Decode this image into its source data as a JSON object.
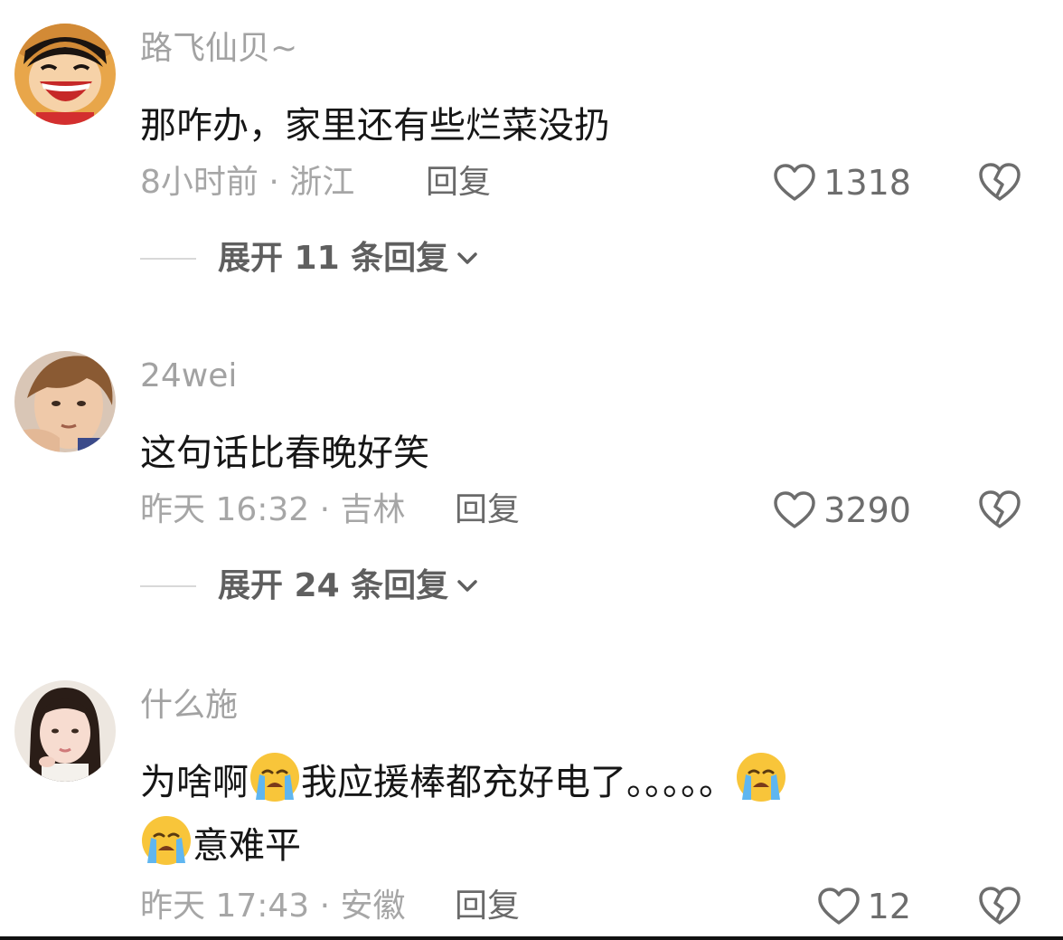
{
  "comments": [
    {
      "username": "路飞仙贝~",
      "text": "那咋办，家里还有些烂菜没扔",
      "time_location": "8小时前 · 浙江",
      "reply_label": "回复",
      "likes": "1318",
      "expand_label": "展开 11 条回复",
      "avatar": "avatar-cartoon-boy-icon"
    },
    {
      "username": "24wei",
      "text": "这句话比春晚好笑",
      "time_location": "昨天 16:32 · 吉林",
      "reply_label": "回复",
      "likes": "3290",
      "expand_label": "展开 24 条回复",
      "avatar": "avatar-young-man-icon"
    },
    {
      "username": "什么施",
      "text_part1": "为啥啊",
      "text_part2": "我应援棒都充好电了。。。。。",
      "text_part3": "意难平",
      "time_location": "昨天 17:43 · 安徽",
      "reply_label": "回复",
      "likes": "12",
      "avatar": "avatar-young-woman-icon"
    }
  ],
  "icons": {
    "like": "heart-icon",
    "dislike": "broken-heart-icon",
    "expand": "chevron-down-icon",
    "crying": "loudly-crying-face-emoji"
  },
  "colors": {
    "username": "#a2a2a2",
    "text": "#161616",
    "meta": "#a6a6a6",
    "reply": "#6a6a6a",
    "expand": "#5f5f5f"
  }
}
